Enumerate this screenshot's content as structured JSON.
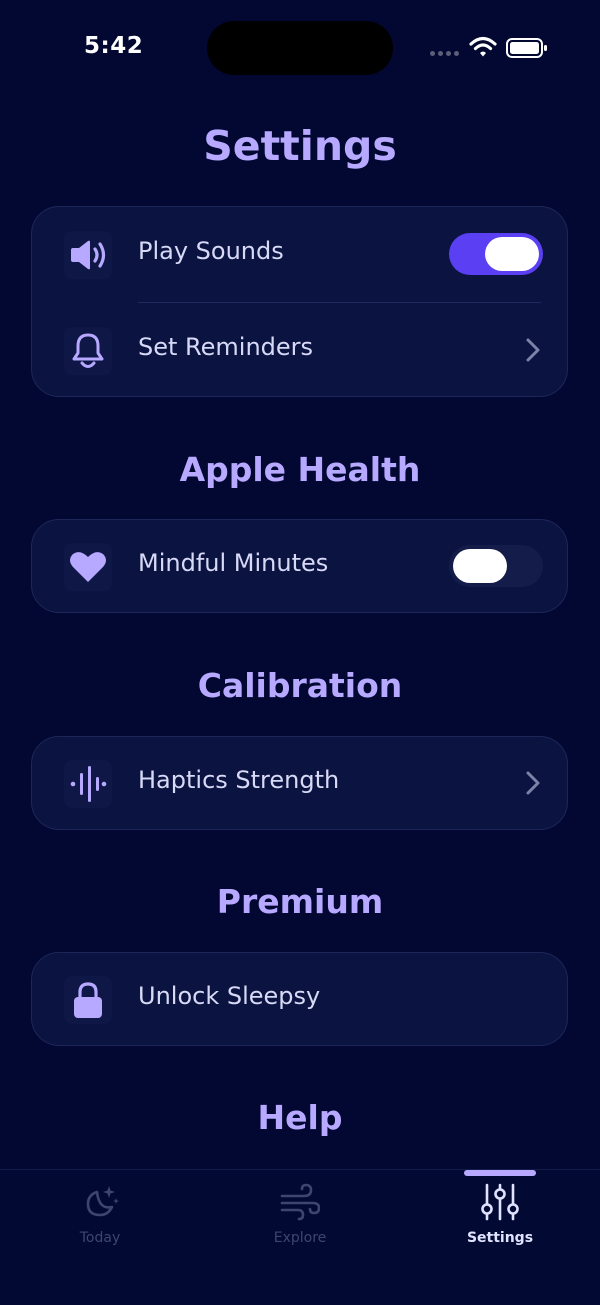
{
  "status_bar": {
    "time": "5:42"
  },
  "page_title": "Settings",
  "general": {
    "play_sounds": {
      "label": "Play Sounds",
      "icon": "speaker-icon",
      "toggle": true
    },
    "set_reminders": {
      "label": "Set Reminders",
      "icon": "bell-icon"
    }
  },
  "apple_health": {
    "title": "Apple Health",
    "mindful_minutes": {
      "label": "Mindful Minutes",
      "icon": "heart-icon",
      "toggle": false
    }
  },
  "calibration": {
    "title": "Calibration",
    "haptics_strength": {
      "label": "Haptics Strength",
      "icon": "waveform-icon"
    }
  },
  "premium": {
    "title": "Premium",
    "unlock": {
      "label": "Unlock Sleepsy",
      "icon": "lock-icon"
    }
  },
  "help": {
    "title": "Help"
  },
  "tab_bar": {
    "tabs": [
      {
        "label": "Today",
        "icon": "moon-stars-icon",
        "active": false
      },
      {
        "label": "Explore",
        "icon": "wind-icon",
        "active": false
      },
      {
        "label": "Settings",
        "icon": "sliders-icon",
        "active": true
      }
    ]
  },
  "colors": {
    "background": "#020832",
    "accent": "#b7a9ff",
    "toggle_on": "#5b3ff2",
    "card": "#0b1441"
  }
}
